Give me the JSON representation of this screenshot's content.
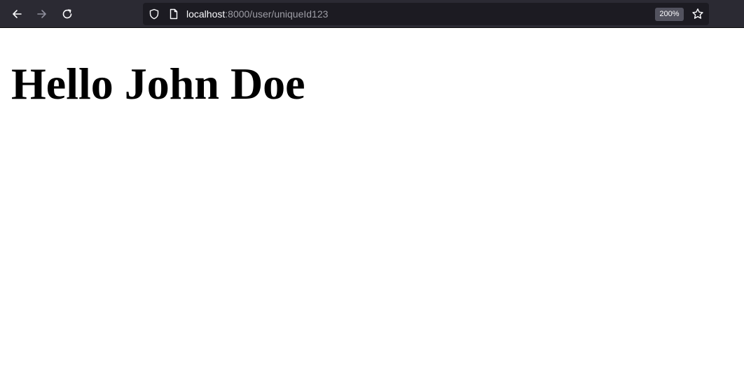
{
  "browser": {
    "nav": {
      "back_icon": "arrow-left-icon",
      "forward_icon": "arrow-right-icon",
      "reload_icon": "reload-icon"
    },
    "urlbar": {
      "tracking_icon": "shield-icon",
      "page_icon": "document-icon",
      "url_host": "localhost",
      "url_rest": ":8000/user/uniqueId123",
      "zoom_level": "200%",
      "bookmark_icon": "star-icon"
    },
    "colors": {
      "toolbar_bg": "#2b2a33",
      "urlbar_bg": "#1c1b22",
      "icon_fg": "#fbfbfe",
      "disabled_icon_fg": "#8f8f9d"
    }
  },
  "page": {
    "heading": "Hello John Doe"
  }
}
